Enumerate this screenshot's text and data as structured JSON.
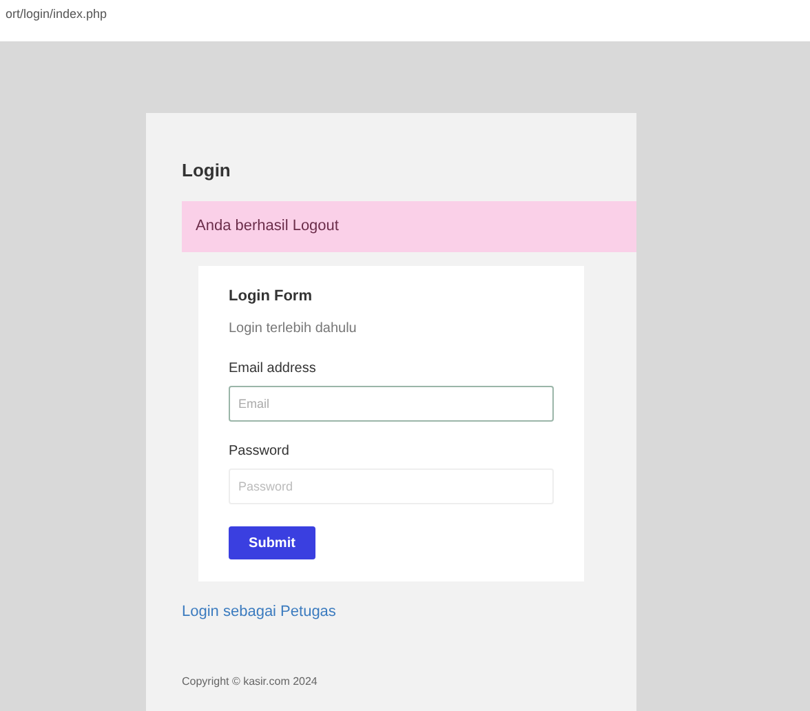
{
  "address_bar": {
    "url": "ort/login/index.php"
  },
  "page": {
    "title": "Login",
    "alert": "Anda berhasil Logout",
    "form": {
      "title": "Login Form",
      "subtitle": "Login terlebih dahulu",
      "fields": [
        {
          "label": "Email address",
          "placeholder": "Email",
          "focused": true
        },
        {
          "label": "Password",
          "placeholder": "Password",
          "focused": false
        }
      ],
      "submit": "Submit"
    },
    "link": "Login sebagai Petugas",
    "footer": "Copyright © kasir.com 2024"
  }
}
